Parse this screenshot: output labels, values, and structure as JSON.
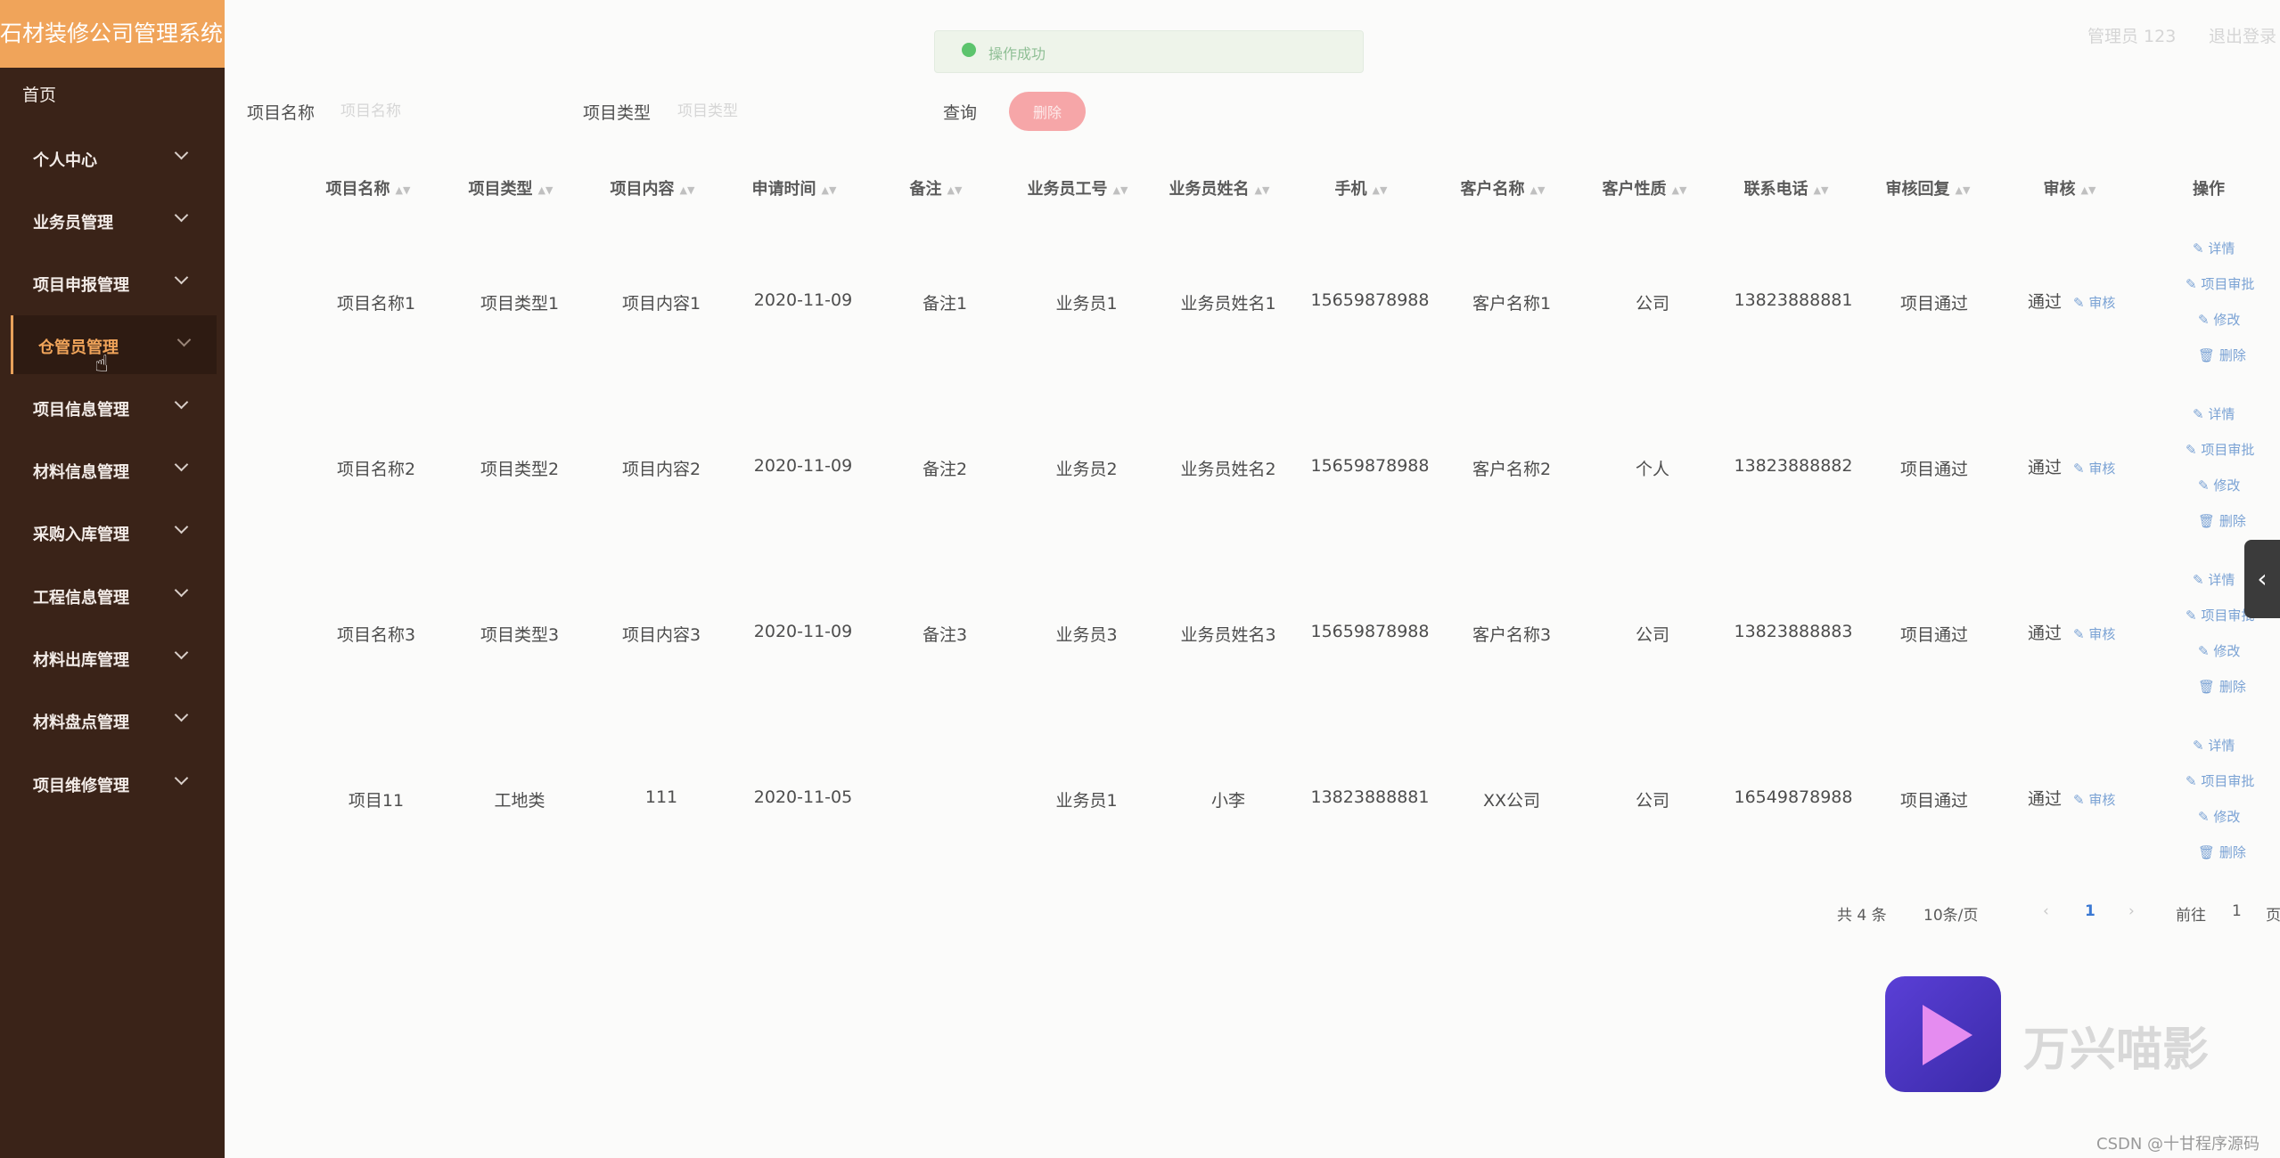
{
  "app": {
    "title": "石材装修公司管理系统",
    "user_label": "管理员 123",
    "logout_label": "退出登录",
    "toast_text": "操作成功"
  },
  "sidebar": {
    "home": "首页",
    "items": [
      {
        "label": "个人中心"
      },
      {
        "label": "业务员管理"
      },
      {
        "label": "项目申报管理"
      },
      {
        "label": "仓管员管理"
      },
      {
        "label": "项目信息管理"
      },
      {
        "label": "材料信息管理"
      },
      {
        "label": "采购入库管理"
      },
      {
        "label": "工程信息管理"
      },
      {
        "label": "材料出库管理"
      },
      {
        "label": "材料盘点管理"
      },
      {
        "label": "项目维修管理"
      }
    ]
  },
  "search": {
    "name_label": "项目名称",
    "name_placeholder": "项目名称",
    "type_label": "项目类型",
    "type_placeholder": "项目类型",
    "query_label": "查询",
    "delete_label": "删除"
  },
  "table": {
    "headers": [
      "项目名称",
      "项目类型",
      "项目内容",
      "申请时间",
      "备注",
      "业务员工号",
      "业务员姓名",
      "手机",
      "客户名称",
      "客户性质",
      "联系电话",
      "审核回复",
      "审核",
      "操作"
    ],
    "rows": [
      [
        "项目名称1",
        "项目类型1",
        "项目内容1",
        "2020-11-09",
        "备注1",
        "业务员1",
        "业务员姓名1",
        "15659878988",
        "客户名称1",
        "公司",
        "13823888881",
        "项目通过",
        "通过"
      ],
      [
        "项目名称2",
        "项目类型2",
        "项目内容2",
        "2020-11-09",
        "备注2",
        "业务员2",
        "业务员姓名2",
        "15659878988",
        "客户名称2",
        "个人",
        "13823888882",
        "项目通过",
        "通过"
      ],
      [
        "项目名称3",
        "项目类型3",
        "项目内容3",
        "2020-11-09",
        "备注3",
        "业务员3",
        "业务员姓名3",
        "15659878988",
        "客户名称3",
        "公司",
        "13823888883",
        "项目通过",
        "通过"
      ],
      [
        "项目11",
        "工地类",
        "111",
        "2020-11-05",
        "",
        "业务员1",
        "小李",
        "13823888881",
        "XX公司",
        "公司",
        "16549878988",
        "项目通过",
        "通过"
      ]
    ],
    "review_link": "审核",
    "ops": [
      "详情",
      "项目审批",
      "修改",
      "删除"
    ]
  },
  "pagination": {
    "total": "共 4 条",
    "page_size": "10条/页",
    "prev": "‹",
    "current": "1",
    "next": "›",
    "goto_label": "前往",
    "goto_value": "1",
    "page_suffix": "页"
  },
  "overlay": {
    "watermark_text": "万兴喵影",
    "credit": "CSDN @十甘程序源码"
  },
  "icons": {
    "sort": "sort-icon",
    "chevron": "chevron-down-icon",
    "edit": "edit-icon",
    "trash": "trash-icon"
  },
  "colors": {
    "sidebar_bg": "#3a2318",
    "brand_bg": "#f0a45a",
    "active_text": "#f0a45a",
    "link": "#7aa2d4",
    "delete_button": "#f6a6a8"
  }
}
